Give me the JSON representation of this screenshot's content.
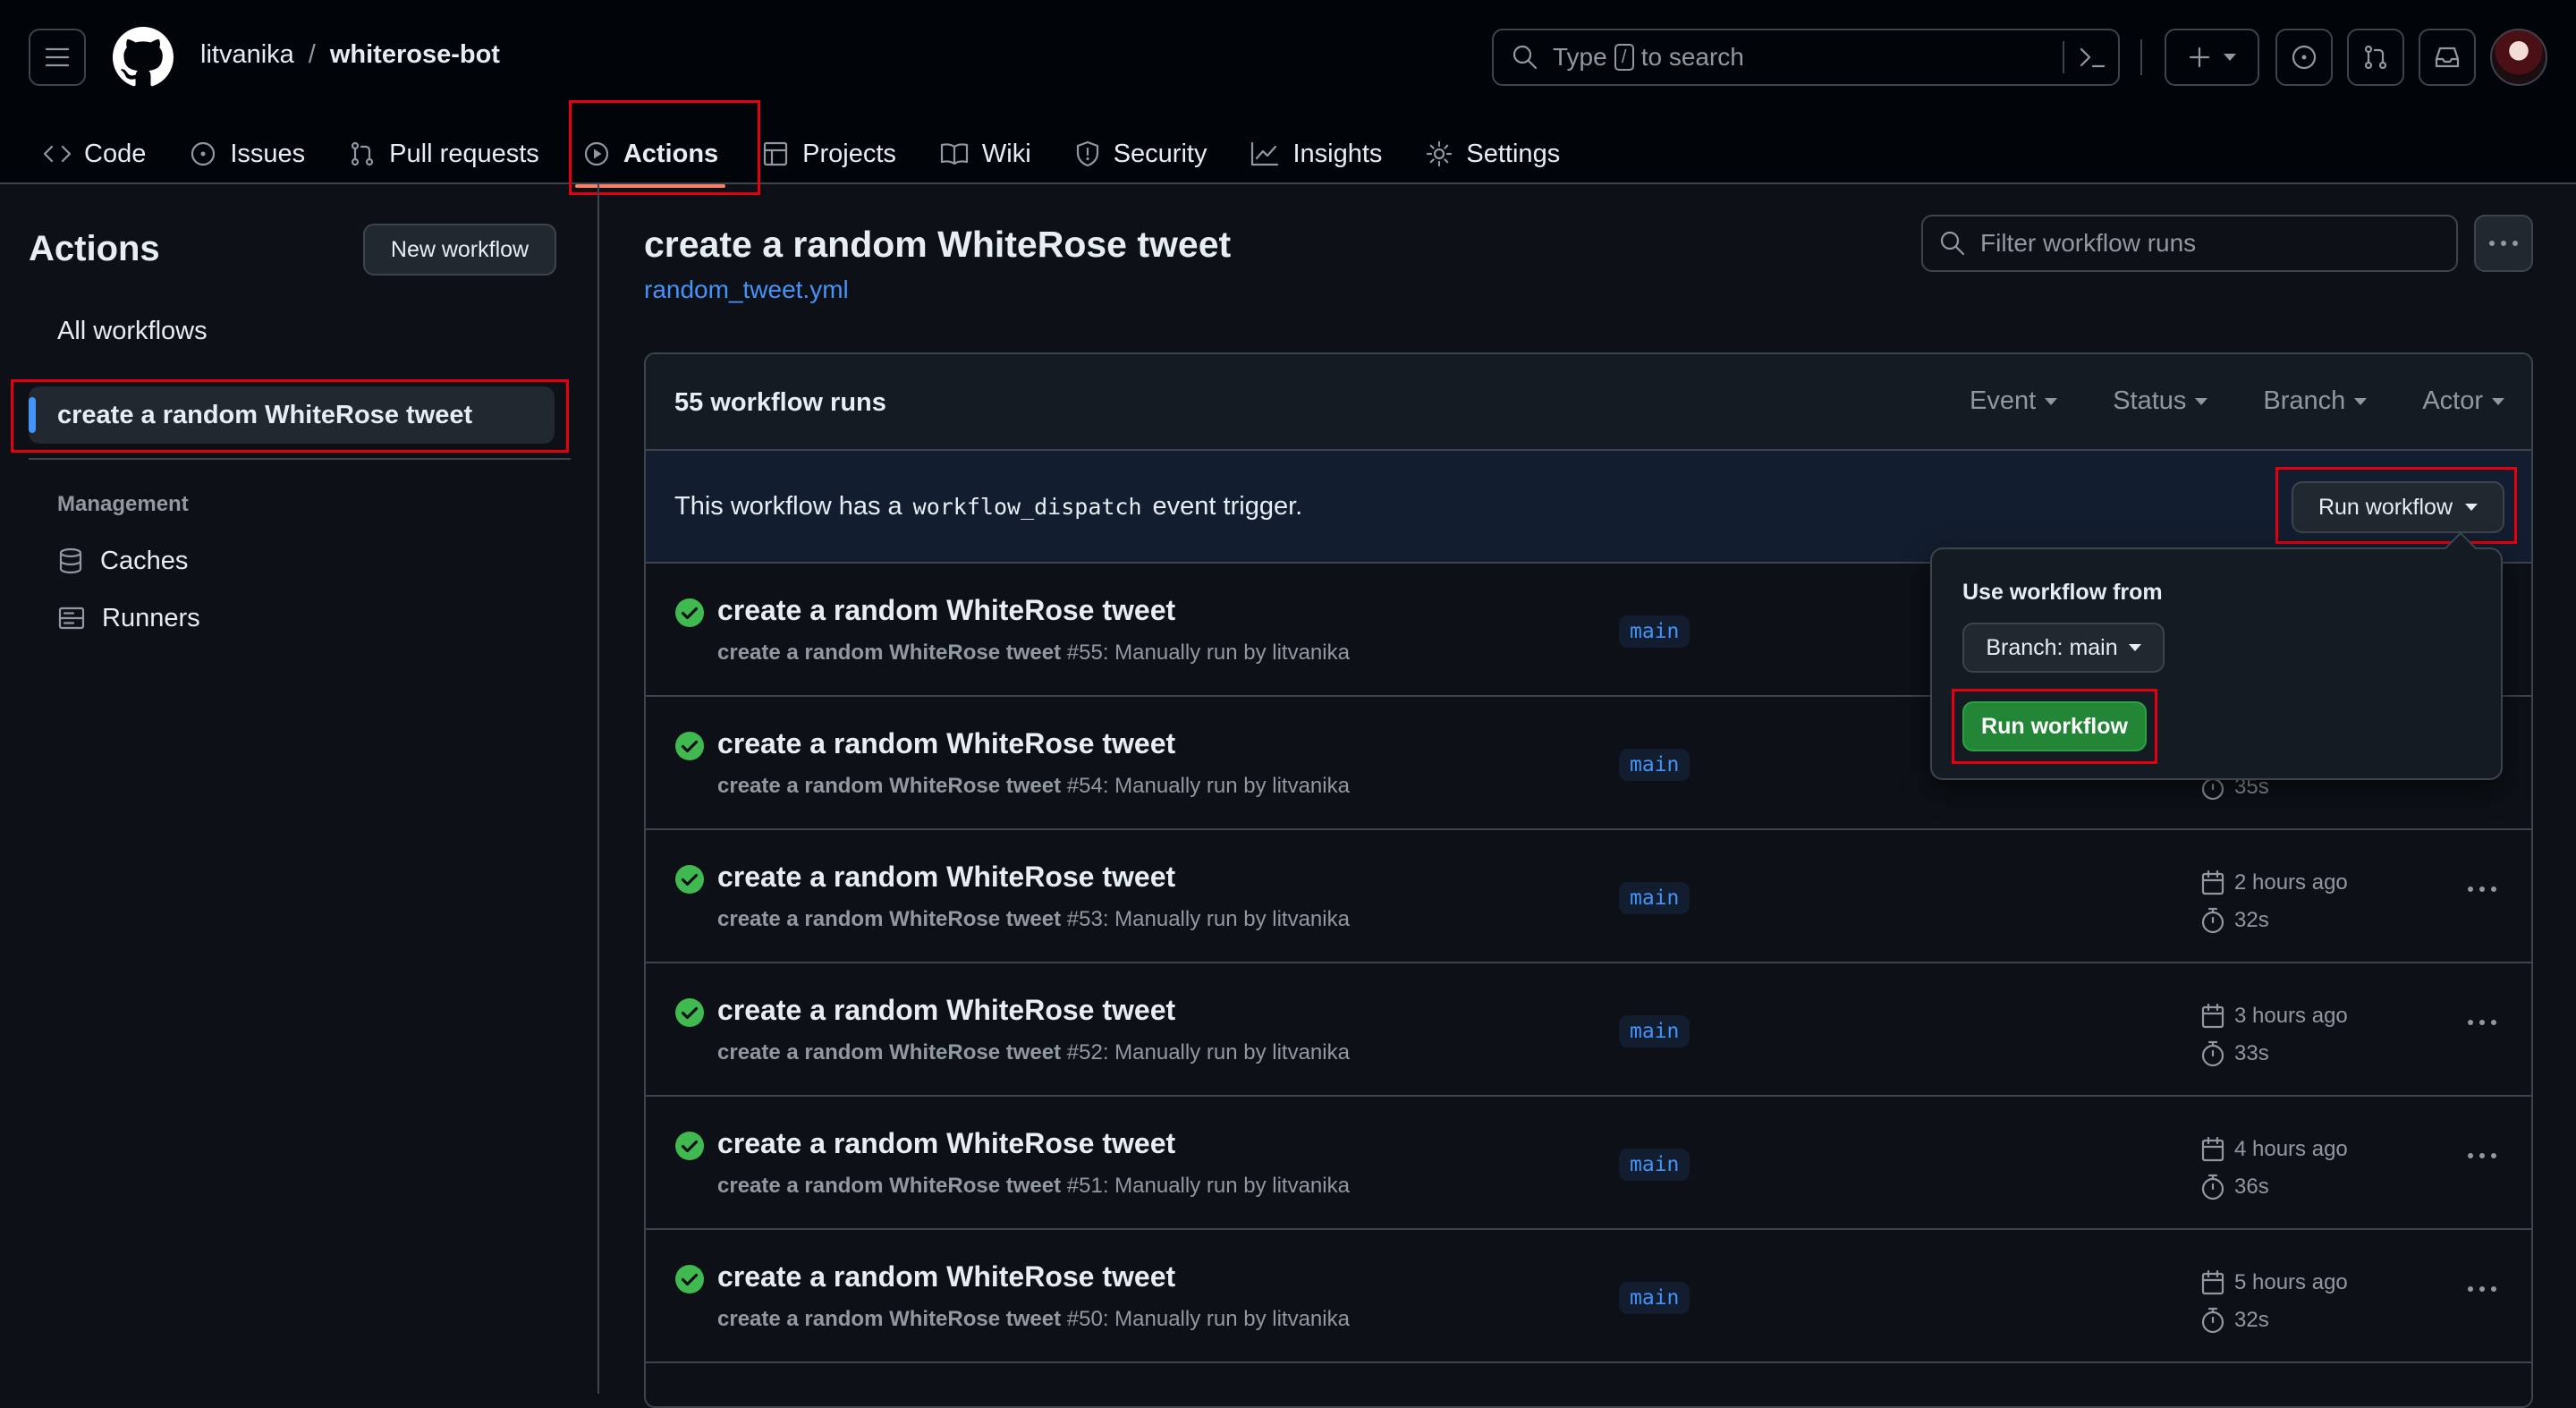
{
  "header": {
    "owner": "litvanika",
    "slash": "/",
    "repo": "whiterose-bot",
    "search": {
      "prefix": "Type",
      "key": "/",
      "suffix": "to search"
    }
  },
  "nav": {
    "tabs": [
      {
        "label": "Code",
        "icon": "code-icon"
      },
      {
        "label": "Issues",
        "icon": "issue-icon"
      },
      {
        "label": "Pull requests",
        "icon": "pull-request-icon"
      },
      {
        "label": "Actions",
        "icon": "play-icon",
        "active": true
      },
      {
        "label": "Projects",
        "icon": "table-icon"
      },
      {
        "label": "Wiki",
        "icon": "book-icon"
      },
      {
        "label": "Security",
        "icon": "shield-icon"
      },
      {
        "label": "Insights",
        "icon": "graph-icon"
      },
      {
        "label": "Settings",
        "icon": "gear-icon"
      }
    ]
  },
  "sidebar": {
    "title": "Actions",
    "new_workflow": "New workflow",
    "all_workflows": "All workflows",
    "selected_workflow": "create a random WhiteRose tweet",
    "management_label": "Management",
    "management": [
      {
        "label": "Caches",
        "icon": "database-icon"
      },
      {
        "label": "Runners",
        "icon": "server-icon"
      }
    ]
  },
  "main": {
    "title": "create a random WhiteRose tweet",
    "file": "random_tweet.yml",
    "filter_placeholder": "Filter workflow runs",
    "runs_count": "55 workflow runs",
    "filters": [
      "Event",
      "Status",
      "Branch",
      "Actor"
    ],
    "dispatch": {
      "prefix": "This workflow has a",
      "code": "workflow_dispatch",
      "suffix": "event trigger."
    },
    "run_workflow_button": "Run workflow",
    "runs": [
      {
        "title": "create a random WhiteRose tweet",
        "name": "create a random WhiteRose tweet",
        "number": "#55",
        "detail": ": Manually run by litvanika",
        "branch": "main",
        "time": "",
        "duration": ""
      },
      {
        "title": "create a random WhiteRose tweet",
        "name": "create a random WhiteRose tweet",
        "number": "#54",
        "detail": ": Manually run by litvanika",
        "branch": "main",
        "time": "",
        "duration": "35s"
      },
      {
        "title": "create a random WhiteRose tweet",
        "name": "create a random WhiteRose tweet",
        "number": "#53",
        "detail": ": Manually run by litvanika",
        "branch": "main",
        "time": "2 hours ago",
        "duration": "32s"
      },
      {
        "title": "create a random WhiteRose tweet",
        "name": "create a random WhiteRose tweet",
        "number": "#52",
        "detail": ": Manually run by litvanika",
        "branch": "main",
        "time": "3 hours ago",
        "duration": "33s"
      },
      {
        "title": "create a random WhiteRose tweet",
        "name": "create a random WhiteRose tweet",
        "number": "#51",
        "detail": ": Manually run by litvanika",
        "branch": "main",
        "time": "4 hours ago",
        "duration": "36s"
      },
      {
        "title": "create a random WhiteRose tweet",
        "name": "create a random WhiteRose tweet",
        "number": "#50",
        "detail": ": Manually run by litvanika",
        "branch": "main",
        "time": "5 hours ago",
        "duration": "32s"
      }
    ]
  },
  "dropdown": {
    "label": "Use workflow from",
    "branch_button": "Branch: main",
    "run_button": "Run workflow"
  },
  "colors": {
    "background": "#0d1117",
    "header": "#010409",
    "border": "#3d444d",
    "accent_blue": "#4493f8",
    "success_green": "#3fb950",
    "primary_button": "#238636",
    "active_tab_underline": "#f78166",
    "highlight_box": "#e5000f"
  }
}
